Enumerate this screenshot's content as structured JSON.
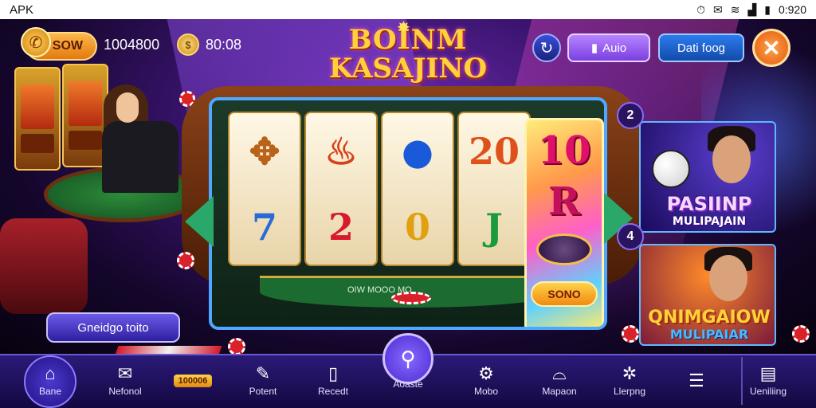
{
  "status_bar": {
    "carrier": "APK",
    "time": "0:920"
  },
  "header": {
    "pill_label": "SOW",
    "balance": "1004800",
    "coins": "80:08",
    "logo_line1": "BOINM",
    "logo_line2": "KASAJINO",
    "ratio_button": "Auio",
    "daily_button": "Dati foog",
    "close_icon": "close-icon"
  },
  "slot": {
    "reels": [
      [
        "✥",
        "7"
      ],
      [
        "♨",
        "2"
      ],
      [
        "●",
        "0"
      ],
      [
        "20",
        "J"
      ]
    ],
    "bonus_reel": [
      "10",
      "R"
    ],
    "bonus_button": "SONO",
    "felt_text": "OIW MOOO MO"
  },
  "promos": [
    {
      "number": "2",
      "title": "PASIINP",
      "subtitle": "MULIPAJAIN"
    },
    {
      "number": "4",
      "title": "QNIMGAIOW",
      "subtitle": "MULIPAIAR"
    }
  ],
  "left_action": "Gneidgo toito",
  "bottom_nav": {
    "items": [
      {
        "label": "Bane",
        "icon": "home-icon"
      },
      {
        "label": "Nefonol",
        "icon": "mail-icon"
      },
      {
        "label": "",
        "badge": "100006",
        "icon": "badge-icon"
      },
      {
        "label": "Potent",
        "icon": "ticket-icon"
      },
      {
        "label": "Recedt",
        "icon": "phone-icon"
      },
      {
        "label": "Aoaste",
        "icon": "search-icon"
      },
      {
        "label": "Mobo",
        "icon": "gear-icon"
      },
      {
        "label": "Mapaon",
        "icon": "bag-icon"
      },
      {
        "label": "Llerpng",
        "icon": "settings-icon"
      },
      {
        "label": "",
        "icon": "list-icon"
      },
      {
        "label": "Ueniliing",
        "icon": "document-icon"
      }
    ]
  }
}
